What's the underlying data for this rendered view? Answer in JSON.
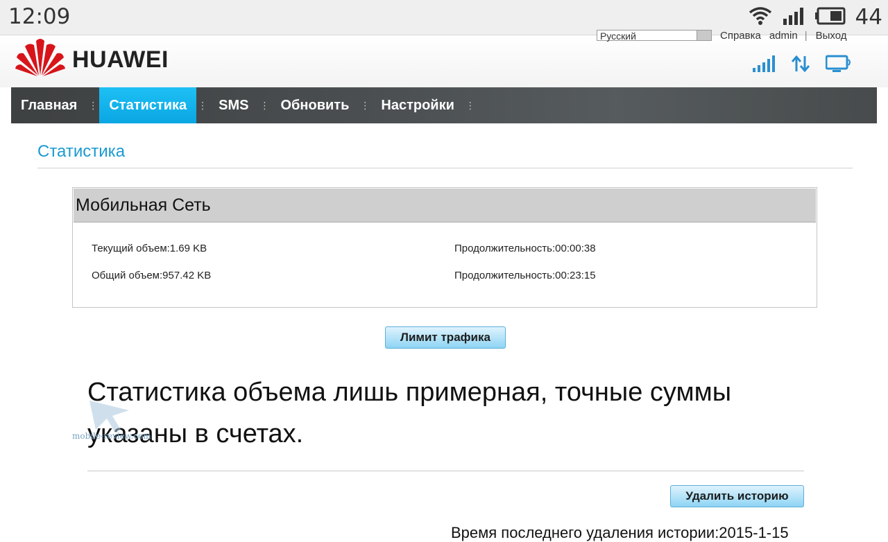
{
  "status_bar": {
    "time": "12:09",
    "battery_percent": "44",
    "icons": [
      "wifi-icon",
      "cell-signal-icon",
      "battery-icon"
    ]
  },
  "header": {
    "brand": "HUAWEI",
    "language": "Русский",
    "help_link": "Справка",
    "user": "admin",
    "separator": "|",
    "logout_link": "Выход",
    "status_icons": [
      "signal-strength-icon",
      "data-transfer-icon",
      "connected-device-icon"
    ]
  },
  "nav": {
    "items": [
      {
        "label": "Главная"
      },
      {
        "label": "Статистика"
      },
      {
        "label": "SMS"
      },
      {
        "label": "Обновить"
      },
      {
        "label": "Настройки"
      }
    ],
    "active_index": 1
  },
  "page": {
    "title": "Статистика",
    "stats": {
      "heading": "Мобильная Сеть",
      "current_volume": "Текущий объем:1.69 KB",
      "current_duration": "Продолжительность:00:00:38",
      "total_volume": "Общий объем:957.42 KB",
      "total_duration": "Продолжительность:00:23:15"
    },
    "traffic_limit_button": "Лимит трафика",
    "note": "Статистика объема лишь примерная, точные суммы указаны в счетах.",
    "delete_history_button": "Удалить историю",
    "last_clear": "Время последнего удаления истории:2015-1-15"
  },
  "watermark": {
    "text": "mobile-review.com"
  },
  "colors": {
    "accent": "#1a9ad0",
    "nav_active": "#11b3ee",
    "nav_bg": "#4a4e50",
    "button": "#8ed4f4"
  }
}
